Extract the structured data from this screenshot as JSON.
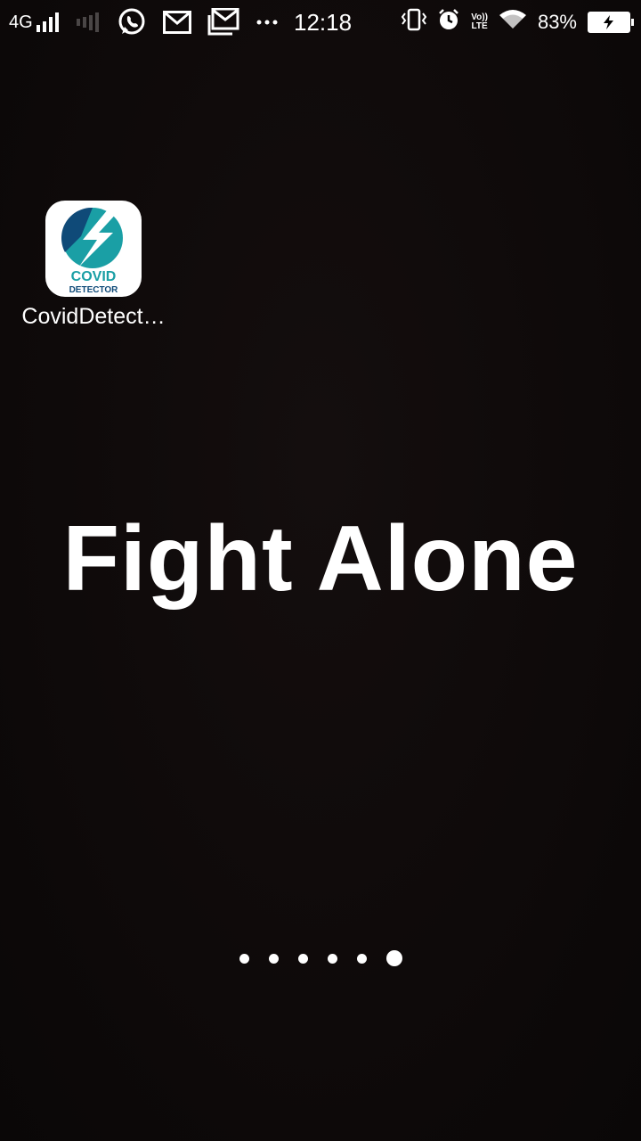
{
  "status_bar": {
    "network": "4G",
    "time": "12:18",
    "volte_top": "Vo))",
    "volte_bottom": "LTE",
    "battery_percent": "83%",
    "icons": [
      "signal-icon",
      "signal-weak-icon",
      "whatsapp-icon",
      "gmail-icon",
      "gmail-icon",
      "more-icon",
      "vibrate-icon",
      "alarm-icon",
      "volte-icon",
      "wifi-icon",
      "battery-charging-icon"
    ]
  },
  "home": {
    "app": {
      "label": "CovidDetect…",
      "icon_line1": "COVID",
      "icon_line2": "DETECTOR"
    },
    "motto": "Fight Alone",
    "page_count": 6,
    "active_page": 6
  },
  "colors": {
    "background": "#0f0a0a",
    "icon_teal": "#1a9fa5",
    "icon_navy": "#0f4a78"
  }
}
